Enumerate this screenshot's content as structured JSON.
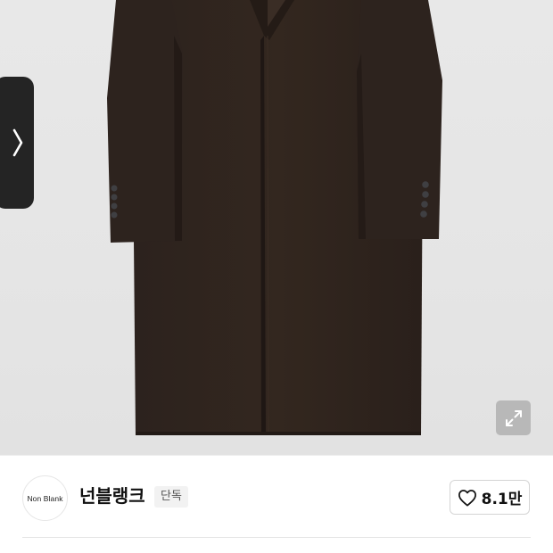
{
  "product_image": {
    "icon": "coat-photo",
    "prev_icon": "chevron-right-icon",
    "expand_icon": "expand-arrows-icon"
  },
  "brand": {
    "logo_text": "Non Blank",
    "name": "넌블랭크",
    "badge": "단독"
  },
  "like": {
    "icon": "heart-outline-icon",
    "count": "8.1만"
  }
}
